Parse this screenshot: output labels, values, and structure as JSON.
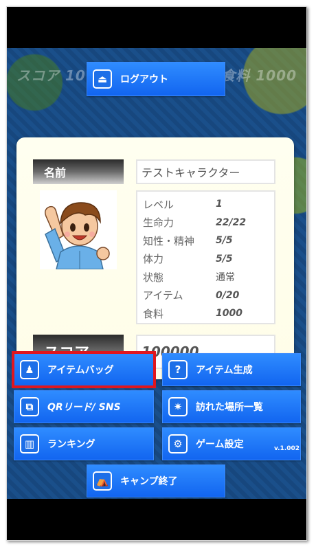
{
  "hud": {
    "score_text": "スコア 10",
    "food_text": "食料 1000"
  },
  "logout_button": "ログアウト",
  "profile": {
    "name_label": "名前",
    "name_value": "テストキャラクター",
    "stats": [
      {
        "key": "レベル",
        "value": "1"
      },
      {
        "key": "生命力",
        "value": "22/22"
      },
      {
        "key": "知性・精神",
        "value": "5/5"
      },
      {
        "key": "体力",
        "value": "5/5"
      },
      {
        "key": "状態",
        "value": "通常"
      },
      {
        "key": "アイテム",
        "value": "0/20"
      },
      {
        "key": "食料",
        "value": "1000"
      }
    ],
    "score_label": "スコア",
    "score_value": "100000"
  },
  "menu": {
    "item_bag": "アイテムバッグ",
    "item_create": "アイテム生成",
    "qr_sns": "QRリード/ SNS",
    "visited_places": "訪れた場所一覧",
    "ranking": "ランキング",
    "game_settings": "ゲーム設定",
    "end_camp": "キャンプ終了"
  },
  "version": "v.1.002",
  "colors": {
    "button_blue": "#1a73f0",
    "selected_outline": "#e0161e"
  }
}
